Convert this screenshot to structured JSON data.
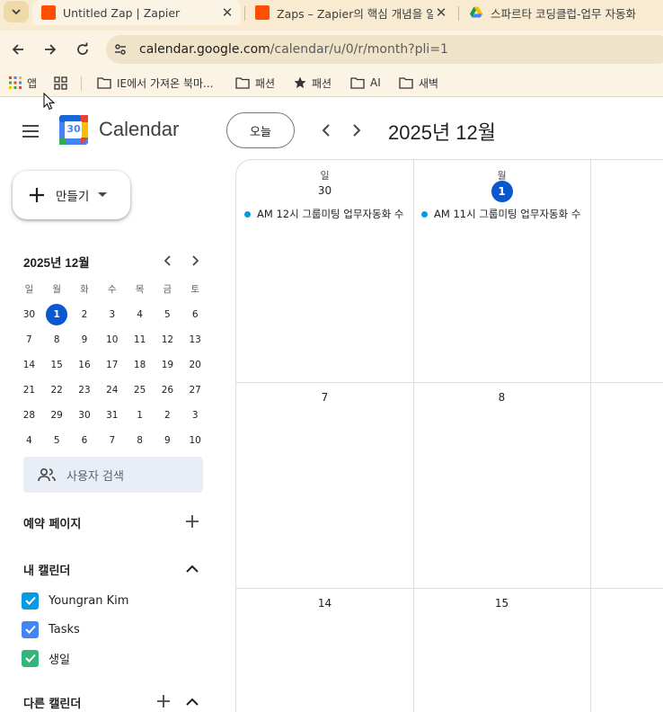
{
  "browser": {
    "tabs": [
      {
        "title": "Untitled Zap | Zapier",
        "favicon_color": "#ff4f00",
        "active": true
      },
      {
        "title": "Zaps – Zapier의 핵심 개념을 알",
        "favicon_color": "#ff4f00",
        "active": false
      },
      {
        "title": "스파르타 코딩클럽-업무 자동화",
        "favicon": "google-drive-icon",
        "active": false
      }
    ],
    "tab_close": "✕",
    "url_host": "calendar.google.com",
    "url_path": "/calendar/u/0/r/month?pli=1",
    "bookmarks": [
      {
        "label": "앱",
        "icon": "apps-grid-icon"
      },
      {
        "label": "",
        "icon": "tab-groups-icon"
      },
      {
        "label": "IE에서 가져온 북마...",
        "icon": "folder-icon"
      },
      {
        "label": "패션",
        "icon": "folder-icon"
      },
      {
        "label": "패션",
        "icon": "star-icon"
      },
      {
        "label": "AI",
        "icon": "folder-icon"
      },
      {
        "label": "새벽",
        "icon": "folder-icon"
      }
    ]
  },
  "header": {
    "brand": "Calendar",
    "logo_day": "30",
    "today_label": "오늘",
    "month_title": "2025년 12월"
  },
  "sidebar": {
    "create_label": "만들기",
    "mini_calendar": {
      "title": "2025년 12월",
      "weekdays": [
        "일",
        "월",
        "화",
        "수",
        "목",
        "금",
        "토"
      ],
      "weeks": [
        [
          "30",
          "1",
          "2",
          "3",
          "4",
          "5",
          "6"
        ],
        [
          "7",
          "8",
          "9",
          "10",
          "11",
          "12",
          "13"
        ],
        [
          "14",
          "15",
          "16",
          "17",
          "18",
          "19",
          "20"
        ],
        [
          "21",
          "22",
          "23",
          "24",
          "25",
          "26",
          "27"
        ],
        [
          "28",
          "29",
          "30",
          "31",
          "1",
          "2",
          "3"
        ],
        [
          "4",
          "5",
          "6",
          "7",
          "8",
          "9",
          "10"
        ]
      ],
      "selected": "1"
    },
    "search_people_placeholder": "사용자 검색",
    "booking_pages": "예약 페이지",
    "my_calendars": {
      "title": "내 캘린더",
      "items": [
        {
          "label": "Youngran Kim",
          "color": "#039be5"
        },
        {
          "label": "Tasks",
          "color": "#4285f4"
        },
        {
          "label": "생일",
          "color": "#33b679"
        }
      ]
    },
    "other_calendars": "다른 캘린더"
  },
  "grid": {
    "columns": [
      {
        "weekday": "일",
        "date": "30",
        "today": false,
        "event": "AM 12시 그룹미팅 업무자동화 수"
      },
      {
        "weekday": "월",
        "date": "1",
        "today": true,
        "event": "AM 11시 그룹미팅 업무자동화 수"
      }
    ],
    "week2": [
      "7",
      "8"
    ],
    "week3": [
      "14",
      "15"
    ],
    "event_color": "#039be5",
    "today_color": "#0b57d0"
  }
}
